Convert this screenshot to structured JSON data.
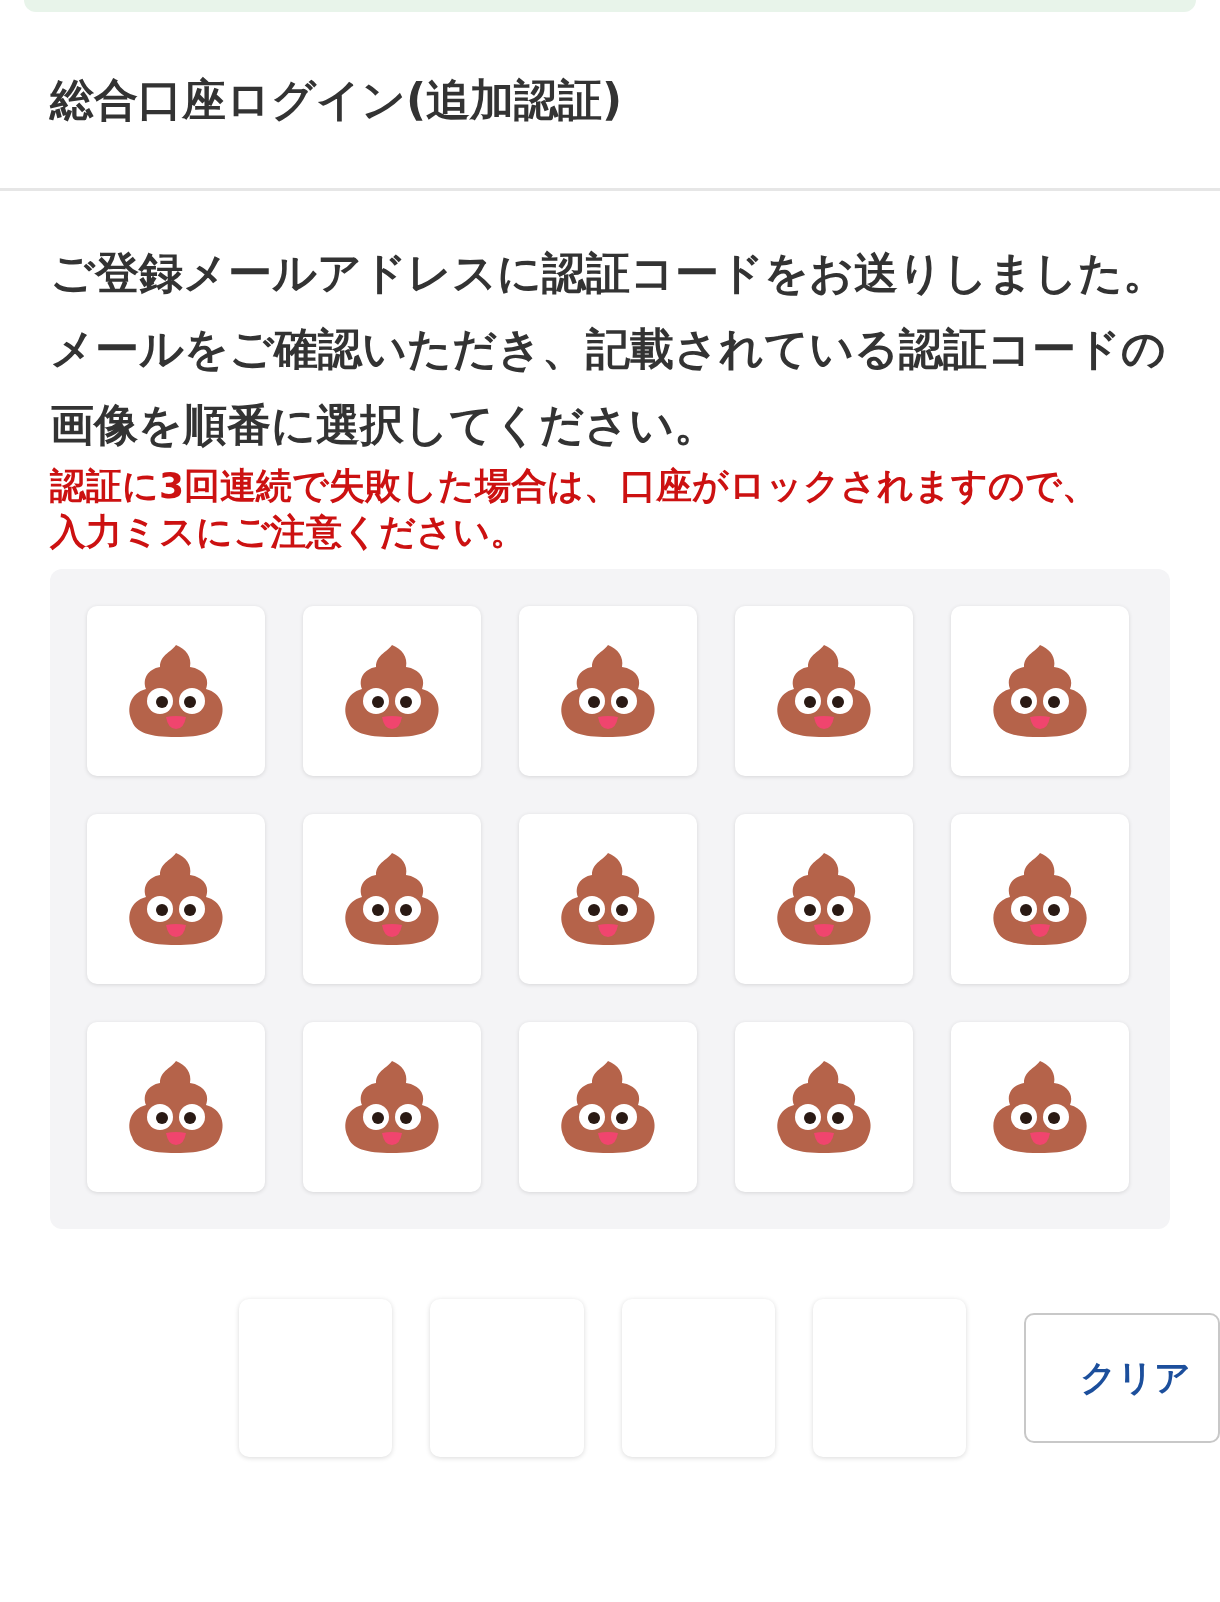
{
  "header": {
    "title": "総合口座ログイン(追加認証)"
  },
  "message": [
    "ご登録メールアドレスに認証コードをお送りしました。",
    "メールをご確認いただき、記載されている認証コードの画像を順番に選択してください。"
  ],
  "warning": "認証に3回連続で失敗した場合は、口座がロックされますので、入力ミスにご注意ください。",
  "tiles": [
    {
      "kind": "poop"
    },
    {
      "kind": "poop"
    },
    {
      "kind": "poop"
    },
    {
      "kind": "poop"
    },
    {
      "kind": "poop"
    },
    {
      "kind": "poop"
    },
    {
      "kind": "poop"
    },
    {
      "kind": "poop"
    },
    {
      "kind": "poop"
    },
    {
      "kind": "poop"
    },
    {
      "kind": "poop"
    },
    {
      "kind": "poop"
    },
    {
      "kind": "poop"
    },
    {
      "kind": "poop"
    },
    {
      "kind": "poop"
    }
  ],
  "answer_slots": [
    {
      "filled": false
    },
    {
      "filled": false
    },
    {
      "filled": false
    },
    {
      "filled": false
    }
  ],
  "clear_button": "クリア"
}
